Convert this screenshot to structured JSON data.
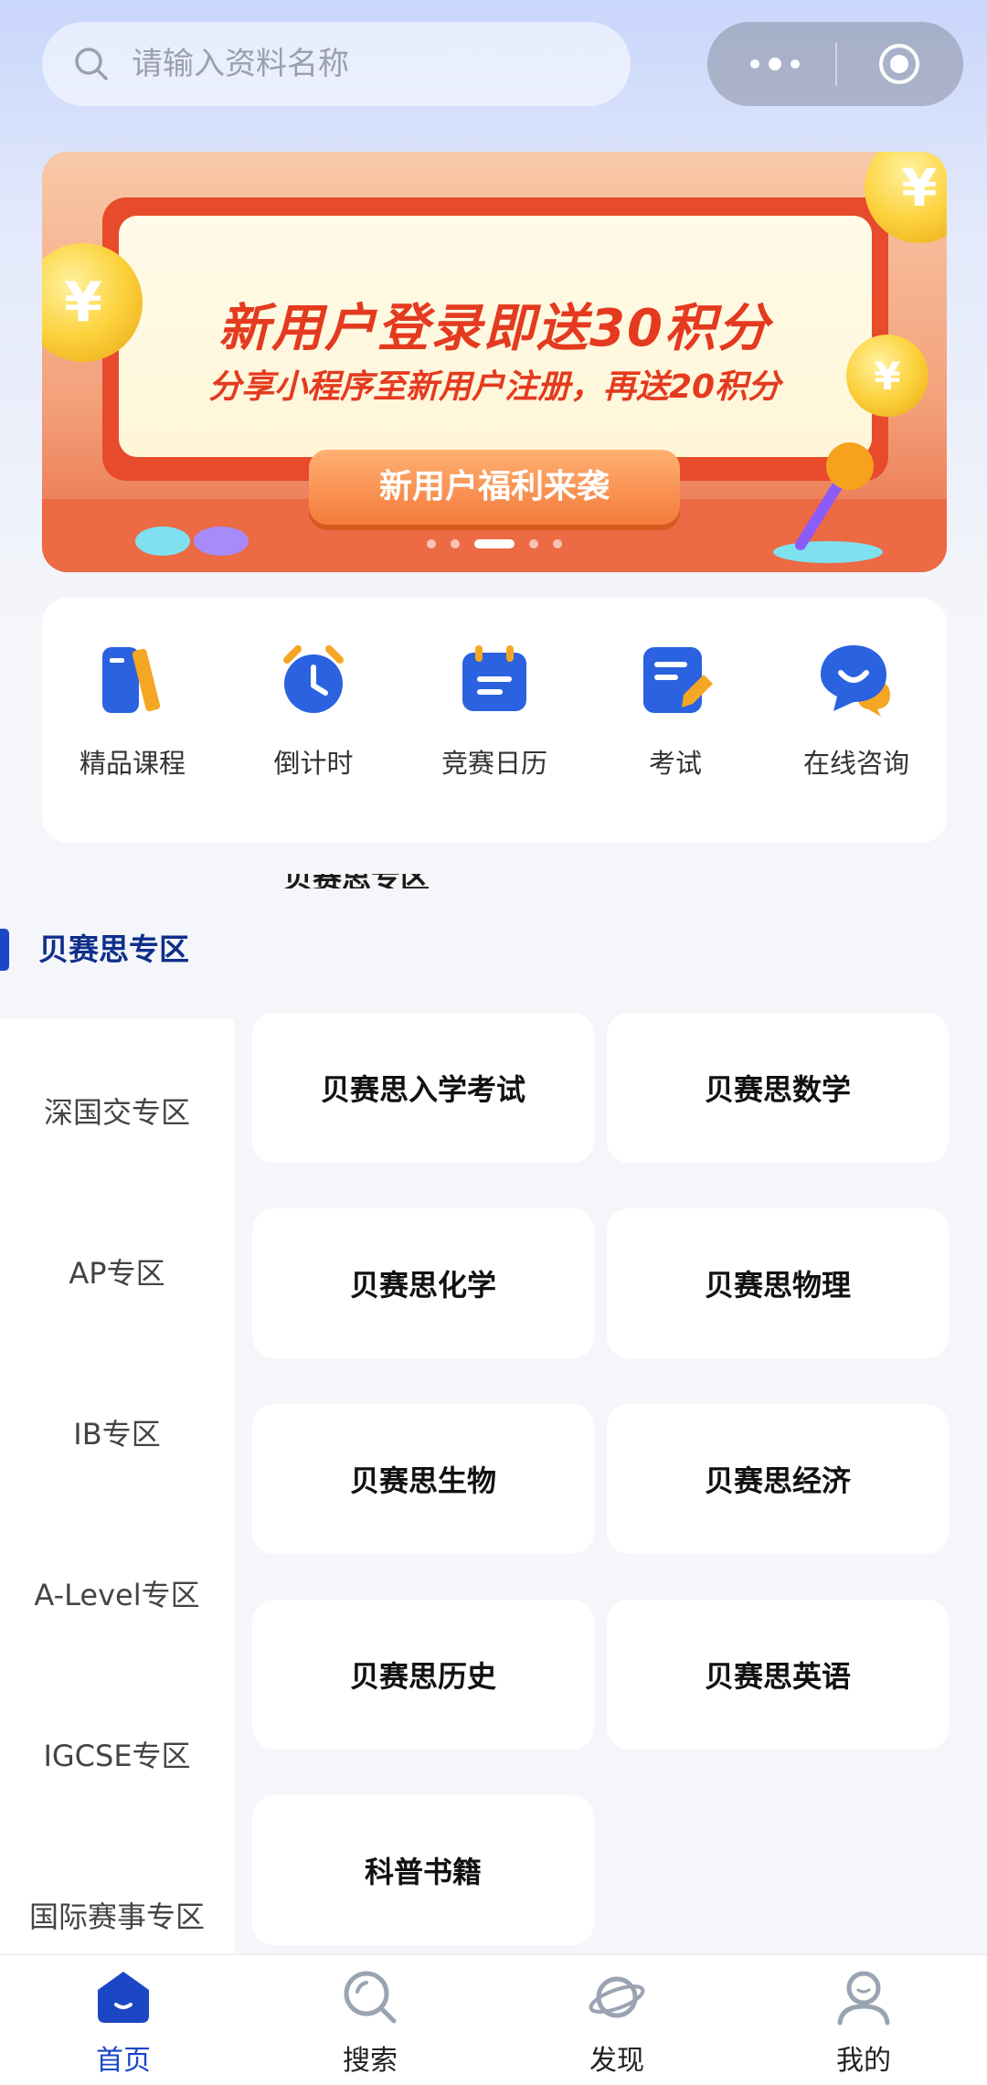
{
  "search": {
    "placeholder": "请输入资料名称"
  },
  "banner": {
    "headline": "新用户登录即送30积分",
    "subline": "分享小程序至新用户注册，再送20积分",
    "ribbon": "新用户福利来袭",
    "coin_symbol": "¥",
    "page_count": 5,
    "active_page": 3
  },
  "shortcuts": [
    {
      "label": "精品课程",
      "icon": "course-icon"
    },
    {
      "label": "倒计时",
      "icon": "alarm-clock-icon"
    },
    {
      "label": "竞赛日历",
      "icon": "calendar-icon"
    },
    {
      "label": "考试",
      "icon": "exam-icon"
    },
    {
      "label": "在线咨询",
      "icon": "chat-icon"
    }
  ],
  "clipped_heading": "贝赛思专区",
  "section": {
    "title": "贝赛思专区"
  },
  "left_nav": [
    "深国交专区",
    "AP专区",
    "IB专区",
    "A-Level专区",
    "IGCSE专区",
    "国际赛事专区"
  ],
  "cards": [
    "贝赛思入学考试",
    "贝赛思数学",
    "贝赛思化学",
    "贝赛思物理",
    "贝赛思生物",
    "贝赛思经济",
    "贝赛思历史",
    "贝赛思英语",
    "科普书籍"
  ],
  "tabbar": [
    {
      "label": "首页",
      "icon": "home-icon",
      "active": true
    },
    {
      "label": "搜索",
      "icon": "search-icon"
    },
    {
      "label": "发现",
      "icon": "planet-icon"
    },
    {
      "label": "我的",
      "icon": "profile-icon"
    }
  ],
  "colors": {
    "accent": "#1b47c4",
    "icon_blue": "#2a62e0",
    "icon_orange": "#f5a623",
    "banner_red": "#e43a1f"
  }
}
